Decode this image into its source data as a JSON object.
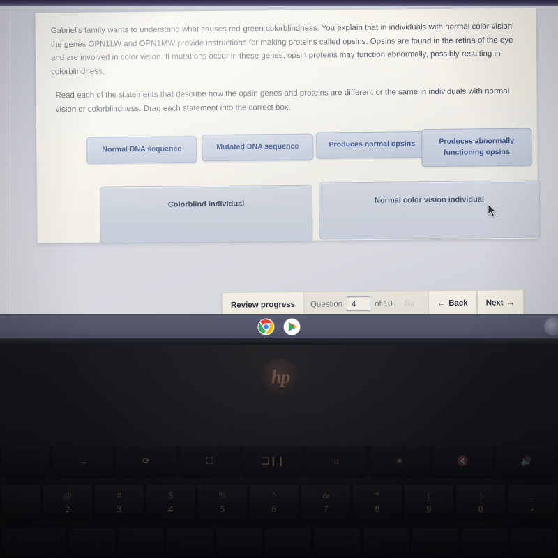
{
  "question": {
    "stem_paragraph_1": "Gabriel's family wants to understand what causes red-green colorblindness. You explain that in individuals with normal color vision the genes OPN1LW and OPN1MW provide instructions for making proteins called opsins. Opsins are found in the retina of the eye and are involved in color vision. If mutations occur in these genes, opsin proteins may function abnormally, possibly resulting in colorblindness.",
    "instruction_paragraph": "Read each of the statements that describe how the opsin genes and proteins are different or the same in individuals with normal vision or colorblindness. Drag each statement into the correct box."
  },
  "draggable_statements": [
    {
      "id": "s1",
      "label": "Normal DNA sequence"
    },
    {
      "id": "s2",
      "label": "Mutated DNA sequence"
    },
    {
      "id": "s3",
      "label": "Produces normal opsins"
    },
    {
      "id": "s4",
      "label": "Produces abnormally functioning opsins"
    }
  ],
  "drop_zones": [
    {
      "id": "z1",
      "label": "Colorblind individual",
      "contents": []
    },
    {
      "id": "z2",
      "label": "Normal color vision individual",
      "contents": []
    }
  ],
  "navigation": {
    "review_progress_label": "Review progress",
    "question_word": "Question",
    "question_number": "4",
    "of_label": "of 10",
    "go_label": "Go",
    "back_label": "Back",
    "back_arrow": "←",
    "next_label": "Next",
    "next_arrow": "→"
  },
  "shelf": {
    "items": [
      {
        "name": "chrome-icon",
        "label": "Google Chrome"
      },
      {
        "name": "play-store-icon",
        "label": "Google Play Store"
      }
    ]
  },
  "device": {
    "brand_logo": "hp"
  },
  "keyboard": {
    "function_row": [
      {
        "glyph": "→",
        "name": "forward-key"
      },
      {
        "glyph": "⟳",
        "name": "reload-key"
      },
      {
        "glyph": "⛶",
        "name": "fullscreen-key"
      },
      {
        "glyph": "❏❙❙",
        "name": "overview-key"
      },
      {
        "glyph": "○",
        "name": "brightness-down-key"
      },
      {
        "glyph": "☀",
        "name": "brightness-up-key"
      },
      {
        "glyph": "🔇",
        "name": "mute-key"
      },
      {
        "glyph": "🔊",
        "name": "volume-down-key"
      }
    ],
    "number_row": [
      {
        "symbol": "@",
        "digit": "2"
      },
      {
        "symbol": "#",
        "digit": "3"
      },
      {
        "symbol": "$",
        "digit": "4"
      },
      {
        "symbol": "%",
        "digit": "5"
      },
      {
        "symbol": "^",
        "digit": "6"
      },
      {
        "symbol": "&",
        "digit": "7"
      },
      {
        "symbol": "*",
        "digit": "8"
      },
      {
        "symbol": "(",
        "digit": "9"
      },
      {
        "symbol": ")",
        "digit": "0"
      },
      {
        "symbol": "_",
        "digit": "-"
      }
    ]
  },
  "colors": {
    "chip_text": "#24417e",
    "chip_fill": "#c6cfdd",
    "zone_fill": "#ccd2dc",
    "card_bg": "#f4f2e9",
    "body_text": "#3c4250",
    "shelf_bg": "#53566a"
  }
}
